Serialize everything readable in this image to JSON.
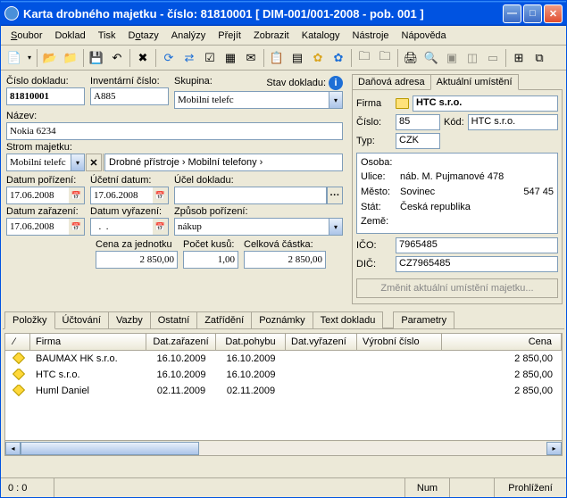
{
  "window": {
    "title": "Karta drobného majetku - číslo: 81810001  [ DIM-001/001-2008 - pob. 001 ]"
  },
  "menu": {
    "soubor": "Soubor",
    "doklad": "Doklad",
    "tisk": "Tisk",
    "dotazy": "Dotazy",
    "analyzy": "Analýzy",
    "prejit": "Přejít",
    "zobrazit": "Zobrazit",
    "katalogy": "Katalogy",
    "nastroje": "Nástroje",
    "napoveda": "Nápověda"
  },
  "labels": {
    "cislo_dokladu": "Číslo dokladu:",
    "inventarni_cislo": "Inventární číslo:",
    "skupina": "Skupina:",
    "stav_dokladu": "Stav dokladu:",
    "nazev": "Název:",
    "strom_majetku": "Strom majetku:",
    "datum_porizeni": "Datum pořízení:",
    "ucetni_datum": "Účetní datum:",
    "ucel_dokladu": "Účel dokladu:",
    "datum_zarazeni": "Datum zařazení:",
    "datum_vyrazeni": "Datum vyřazení:",
    "zpusob_porizeni": "Způsob pořízení:",
    "cena_za_jednotku": "Cena za jednotku",
    "pocet_kusu": "Počet kusů:",
    "celkova_castka": "Celková částka:"
  },
  "fields": {
    "cislo_dokladu": "81810001",
    "inventarni_cislo": "A885",
    "skupina": "Mobilní telefc",
    "nazev": "Nokia 6234",
    "strom_combo": "Mobilní telefc",
    "breadcrumb_1": "Drobné přístroje",
    "breadcrumb_2": "Mobilní telefony",
    "datum_porizeni": "17.06.2008",
    "ucetni_datum": "17.06.2008",
    "ucel_dokladu": "",
    "datum_zarazeni": "17.06.2008",
    "datum_vyrazeni": "  .  .",
    "zpusob_porizeni": "nákup",
    "cena_za_jednotku": "2 850,00",
    "pocet_kusu": "1,00",
    "celkova_castka": "2 850,00"
  },
  "right_tabs": {
    "dan": "Daňová adresa",
    "akt": "Aktuální umístění"
  },
  "right": {
    "firma_lbl": "Firma",
    "firma": "HTC s.r.o.",
    "cislo_lbl": "Číslo:",
    "cislo": "85",
    "kod_lbl": "Kód:",
    "kod": "HTC s.r.o.",
    "typ_lbl": "Typ:",
    "typ": "CZK",
    "osoba_lbl": "Osoba:",
    "ulice_lbl": "Ulice:",
    "ulice": "náb. M. Pujmanové 478",
    "mesto_lbl": "Město:",
    "mesto": "Sovinec",
    "psc": "547 45",
    "stat_lbl": "Stát:",
    "stat": "Česká republika",
    "zeme_lbl": "Země:",
    "ico_lbl": "IČO:",
    "ico": "7965485",
    "dic_lbl": "DIČ:",
    "dic": "CZ7965485",
    "change_btn": "Změnit aktuální umístění majetku..."
  },
  "mid_tabs": {
    "polozky": "Položky",
    "uctovani": "Účtování",
    "vazby": "Vazby",
    "ostatni": "Ostatní",
    "zatrideni": "Zatřídění",
    "poznamky": "Poznámky",
    "text_dokladu": "Text dokladu",
    "parametry": "Parametry"
  },
  "grid": {
    "headers": {
      "firma": "Firma",
      "datz": "Dat.zařazení",
      "datp": "Dat.pohybu",
      "datv": "Dat.vyřazení",
      "vc": "Výrobní číslo",
      "cena": "Cena"
    },
    "rows": [
      {
        "firma": "BAUMAX HK s.r.o.",
        "datz": "16.10.2009",
        "datp": "16.10.2009",
        "datv": "",
        "vc": "",
        "cena": "2 850,00"
      },
      {
        "firma": "HTC s.r.o.",
        "datz": "16.10.2009",
        "datp": "16.10.2009",
        "datv": "",
        "vc": "",
        "cena": "2 850,00"
      },
      {
        "firma": "Huml Daniel",
        "datz": "02.11.2009",
        "datp": "02.11.2009",
        "datv": "",
        "vc": "",
        "cena": "2 850,00"
      }
    ]
  },
  "status": {
    "pos": "0 :   0",
    "num": "Num",
    "mode": "Prohlížení"
  }
}
